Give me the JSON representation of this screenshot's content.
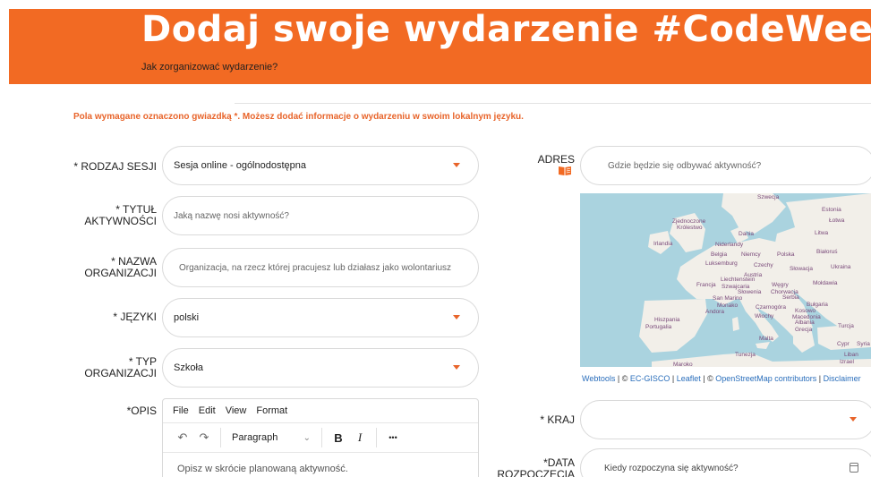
{
  "banner": {
    "title": "Dodaj swoje wydarzenie #CodeWeek",
    "subtitle": "Jak zorganizować wydarzenie?"
  },
  "notice": "Pola wymagane oznaczono gwiazdką *. Możesz dodać informacje o wydarzeniu w swoim lokalnym języku.",
  "form": {
    "session_type": {
      "label": "* RODZAJ SESJI",
      "value": "Sesja online - ogólnodostępna"
    },
    "title": {
      "label_1": "* TYTUŁ",
      "label_2": "AKTYWNOŚCI",
      "placeholder": "Jaką nazwę nosi aktywność?"
    },
    "organization": {
      "label_1": "* NAZWA",
      "label_2": "ORGANIZACJI",
      "placeholder": "Organizacja, na rzecz której pracujesz lub działasz jako wolontariusz"
    },
    "languages": {
      "label": "* JĘZYKI",
      "value": "polski"
    },
    "org_type": {
      "label_1": "* TYP",
      "label_2": "ORGANIZACJI",
      "value": "Szkoła"
    },
    "description": {
      "label": "*OPIS",
      "placeholder": "Opisz w skrócie planowaną aktywność."
    },
    "address": {
      "label": "ADRES",
      "placeholder": "Gdzie będzie się odbywać aktywność?"
    },
    "country": {
      "label": "* KRAJ",
      "value": ""
    },
    "start_date": {
      "label_1": "*DATA",
      "label_2": "ROZPOCZĘCIA",
      "placeholder": "Kiedy rozpoczyna się aktywność?"
    }
  },
  "editor": {
    "menu": [
      "File",
      "Edit",
      "View",
      "Format"
    ],
    "block_format": "Paragraph",
    "bold": "B",
    "italic": "I",
    "more": "•••"
  },
  "map": {
    "countries": [
      "Szwecja",
      "Estonia",
      "Łotwa",
      "Litwa",
      "Zjednoczone Królestwo",
      "Dania",
      "Irlandia",
      "Niderlandy",
      "Niemcy",
      "Polska",
      "Białoruś",
      "Belgia",
      "Luksemburg",
      "Czechy",
      "Słowacja",
      "Ukraina",
      "Francja",
      "Szwajcaria",
      "Austria",
      "Liechtenstein",
      "Węgry",
      "Mołdawia",
      "Słowenia",
      "Chorwacja",
      "Serbia",
      "San Marino",
      "Monako",
      "Andora",
      "Czarnogóra",
      "Kosowo",
      "Bułgaria",
      "Włochy",
      "Macedonia",
      "Hiszpania",
      "Albania",
      "Portugalia",
      "Grecja",
      "Turcja",
      "Malta",
      "Tunezja",
      "Cypr",
      "Syria",
      "Liban",
      "Izrael",
      "Maroko"
    ],
    "credit": {
      "webtools": "Webtools",
      "sep": " | © ",
      "gisco": "EC-GISCO",
      "leaflet": "Leaflet",
      "osm": "OpenStreetMap contributors",
      "disclaimer": "Disclaimer"
    }
  },
  "colors": {
    "accent": "#f26a23",
    "sea": "#aad3df",
    "land": "#f2efe9"
  }
}
